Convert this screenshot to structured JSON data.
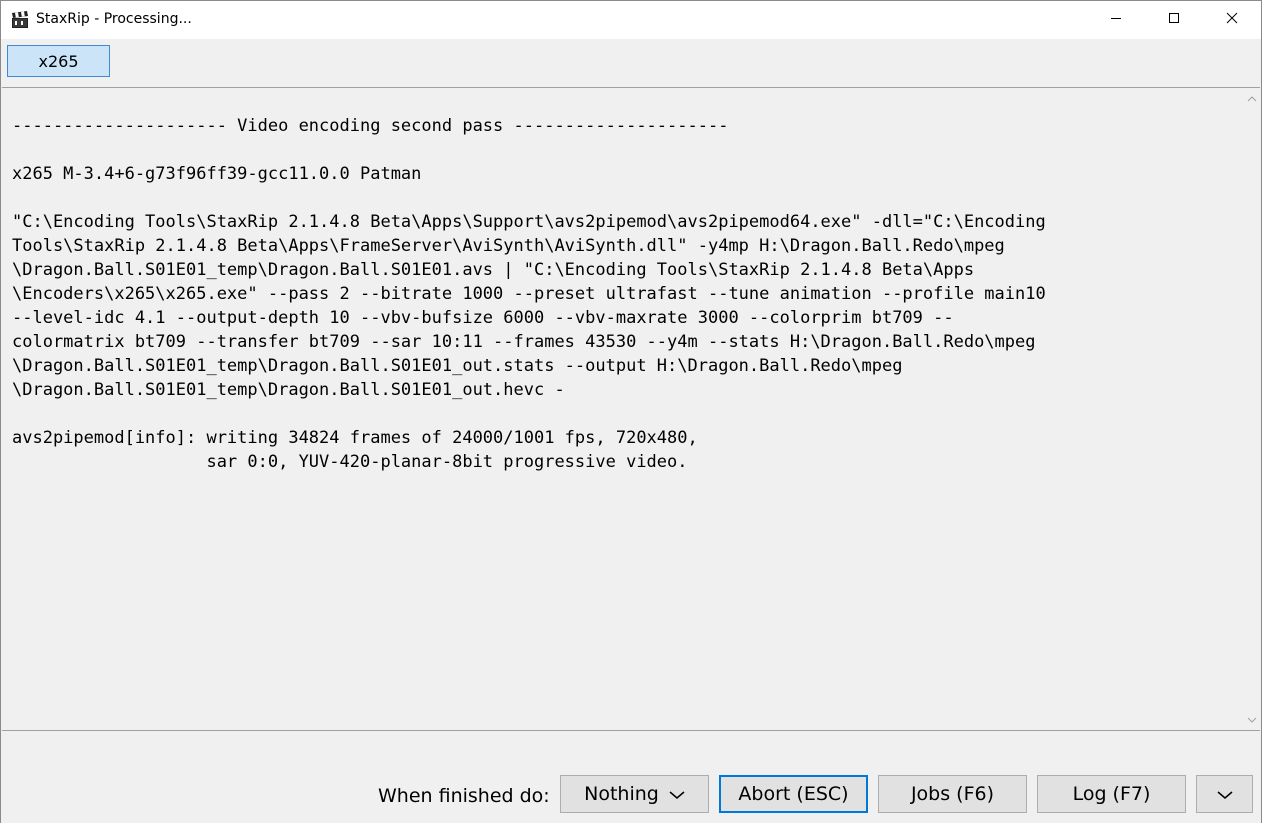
{
  "window": {
    "title": "StaxRip - Processing..."
  },
  "tabs": [
    {
      "label": "x265"
    }
  ],
  "log": {
    "text": "--------------------- Video encoding second pass ---------------------\n\nx265 M-3.4+6-g73f96ff39-gcc11.0.0 Patman\n\n\"C:\\Encoding Tools\\StaxRip 2.1.4.8 Beta\\Apps\\Support\\avs2pipemod\\avs2pipemod64.exe\" -dll=\"C:\\Encoding\nTools\\StaxRip 2.1.4.8 Beta\\Apps\\FrameServer\\AviSynth\\AviSynth.dll\" -y4mp H:\\Dragon.Ball.Redo\\mpeg\n\\Dragon.Ball.S01E01_temp\\Dragon.Ball.S01E01.avs | \"C:\\Encoding Tools\\StaxRip 2.1.4.8 Beta\\Apps\n\\Encoders\\x265\\x265.exe\" --pass 2 --bitrate 1000 --preset ultrafast --tune animation --profile main10\n--level-idc 4.1 --output-depth 10 --vbv-bufsize 6000 --vbv-maxrate 3000 --colorprim bt709 --\ncolormatrix bt709 --transfer bt709 --sar 10:11 --frames 43530 --y4m --stats H:\\Dragon.Ball.Redo\\mpeg\n\\Dragon.Ball.S01E01_temp\\Dragon.Ball.S01E01_out.stats --output H:\\Dragon.Ball.Redo\\mpeg\n\\Dragon.Ball.S01E01_temp\\Dragon.Ball.S01E01_out.hevc -\n\navs2pipemod[info]: writing 34824 frames of 24000/1001 fps, 720x480,\n                   sar 0:0, YUV-420-planar-8bit progressive video."
  },
  "bottom": {
    "finished_label": "When finished do:",
    "finished_selected": "Nothing",
    "abort_label": "Abort (ESC)",
    "jobs_label": "Jobs (F6)",
    "log_label": "Log (F7)"
  },
  "icons": {
    "app": "clapperboard-icon",
    "minimize": "minimize-icon",
    "maximize": "maximize-icon",
    "close": "close-icon",
    "dropdown": "chevron-down-icon",
    "scroll_up": "scroll-up-icon",
    "scroll_down": "scroll-down-icon"
  },
  "colors": {
    "tab_active_bg": "#cce4f7",
    "tab_active_border": "#3e8bd4",
    "focus_border": "#0078d7",
    "button_bg": "#e1e1e1",
    "window_bg": "#f0f0f0"
  }
}
